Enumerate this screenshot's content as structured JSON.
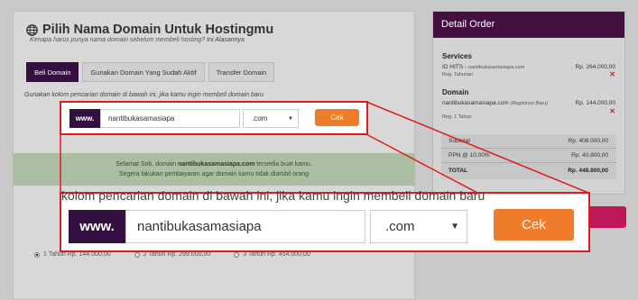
{
  "header": {
    "title": "Pilih Nama Domain Untuk Hostingmu",
    "subtitle": "Kenapa harus punya nama domain sebelum membeli hosting?",
    "subtitle_link": "Ini Alasannya"
  },
  "tabs": [
    {
      "label": "Beli Domain",
      "active": true
    },
    {
      "label": "Gunakan Domain Yang Sudah Aktif",
      "active": false
    },
    {
      "label": "Transfer Domain",
      "active": false
    }
  ],
  "hint": "Gunakan kolom pencarian domain di bawah ini, jika kamu ingin membeli domain baru",
  "search": {
    "prefix": "www.",
    "value": "nantibukasamasiapa",
    "tld": ".com",
    "button": "Cek"
  },
  "success": {
    "before": "Selamat Sob, domain",
    "domain": "nantibukasamasiapa.com",
    "after": "tersedia buat kamu.",
    "line2": "Segera lakukan pembayaran agar domain kamu tidak diambil orang"
  },
  "periods": [
    {
      "label": "1 Tahun Rp. 144.000,00",
      "selected": true
    },
    {
      "label": "2 Tahun Rp. 299.000,00",
      "selected": false
    },
    {
      "label": "3 Tahun Rp. 454.000,00",
      "selected": false
    }
  ],
  "order": {
    "title": "Detail Order",
    "services_label": "Services",
    "service": {
      "name": "ID HITS",
      "domain": "nantibukasamasiapa.com",
      "period": "Reg. Tahunan",
      "price": "Rp. 264.000,00"
    },
    "domain_label": "Domain",
    "domain_item": {
      "name": "nantibukasamasiapa.com",
      "note": "(Registrasi Baru)",
      "period": "Reg. 1 Tahun",
      "price": "Rp. 144.000,00"
    },
    "subtotal_label": "Subtotal",
    "subtotal": "Rp. 408.000,00",
    "ppn_label": "PPN @ 10.00%",
    "ppn": "Rp. 40.800,00",
    "total_label": "TOTAL",
    "total": "Rp. 448.800,00"
  },
  "zoom_ghost_text": "kolom pencarian domain di bawah ini, jika kamu ingin membeli domain baru",
  "colors": {
    "brand": "#33103f",
    "accent": "#f07b2a",
    "highlight": "#e01b1b"
  }
}
